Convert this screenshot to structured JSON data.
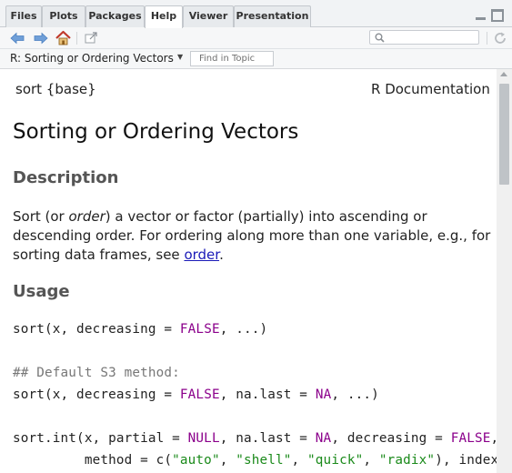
{
  "tabs": [
    {
      "label": "Files"
    },
    {
      "label": "Plots"
    },
    {
      "label": "Packages"
    },
    {
      "label": "Help",
      "active": true
    },
    {
      "label": "Viewer"
    },
    {
      "label": "Presentation"
    }
  ],
  "toolbar": {
    "icons": [
      "back-arrow-icon",
      "forward-arrow-icon",
      "home-icon",
      "popout-icon",
      "search-icon",
      "refresh-icon"
    ],
    "search_value": ""
  },
  "topic_bar": {
    "title": "R: Sorting or Ordering Vectors",
    "find_placeholder": "Find in Topic"
  },
  "doc": {
    "header_left": "sort {base}",
    "header_right": "R Documentation",
    "title": "Sorting or Ordering Vectors",
    "description_heading": "Description",
    "description": {
      "part1": "Sort (or ",
      "emph": "order",
      "part2": ") a vector or factor (partially) into ascending or descending order. For ordering along more than one variable, e.g., for sorting data frames, see ",
      "link": "order",
      "part3": "."
    },
    "usage_heading": "Usage",
    "code": {
      "l1_a": "sort(x, decreasing = ",
      "l1_kw": "FALSE",
      "l1_b": ", ...)",
      "comment": "## Default S3 method:",
      "l2_a": "sort(x, decreasing = ",
      "l2_kw1": "FALSE",
      "l2_b": ", na.last = ",
      "l2_kw2": "NA",
      "l2_c": ", ...)",
      "l3_a": "sort.int(x, partial = ",
      "l3_kw1": "NULL",
      "l3_b": ", na.last = ",
      "l3_kw2": "NA",
      "l3_c": ", decreasing = ",
      "l3_kw3": "FALSE",
      "l3_d": ",",
      "l4_a": "         method = c(",
      "l4_s1": "\"auto\"",
      "l4_b": ", ",
      "l4_s2": "\"shell\"",
      "l4_c": ", ",
      "l4_s3": "\"quick\"",
      "l4_d": ", ",
      "l4_s4": "\"radix\"",
      "l4_e": "), index.retu"
    }
  },
  "colors": {
    "keyword": "#8b008b",
    "string": "#1a8a1a",
    "link": "#1a1ab8",
    "heading": "#555555"
  }
}
